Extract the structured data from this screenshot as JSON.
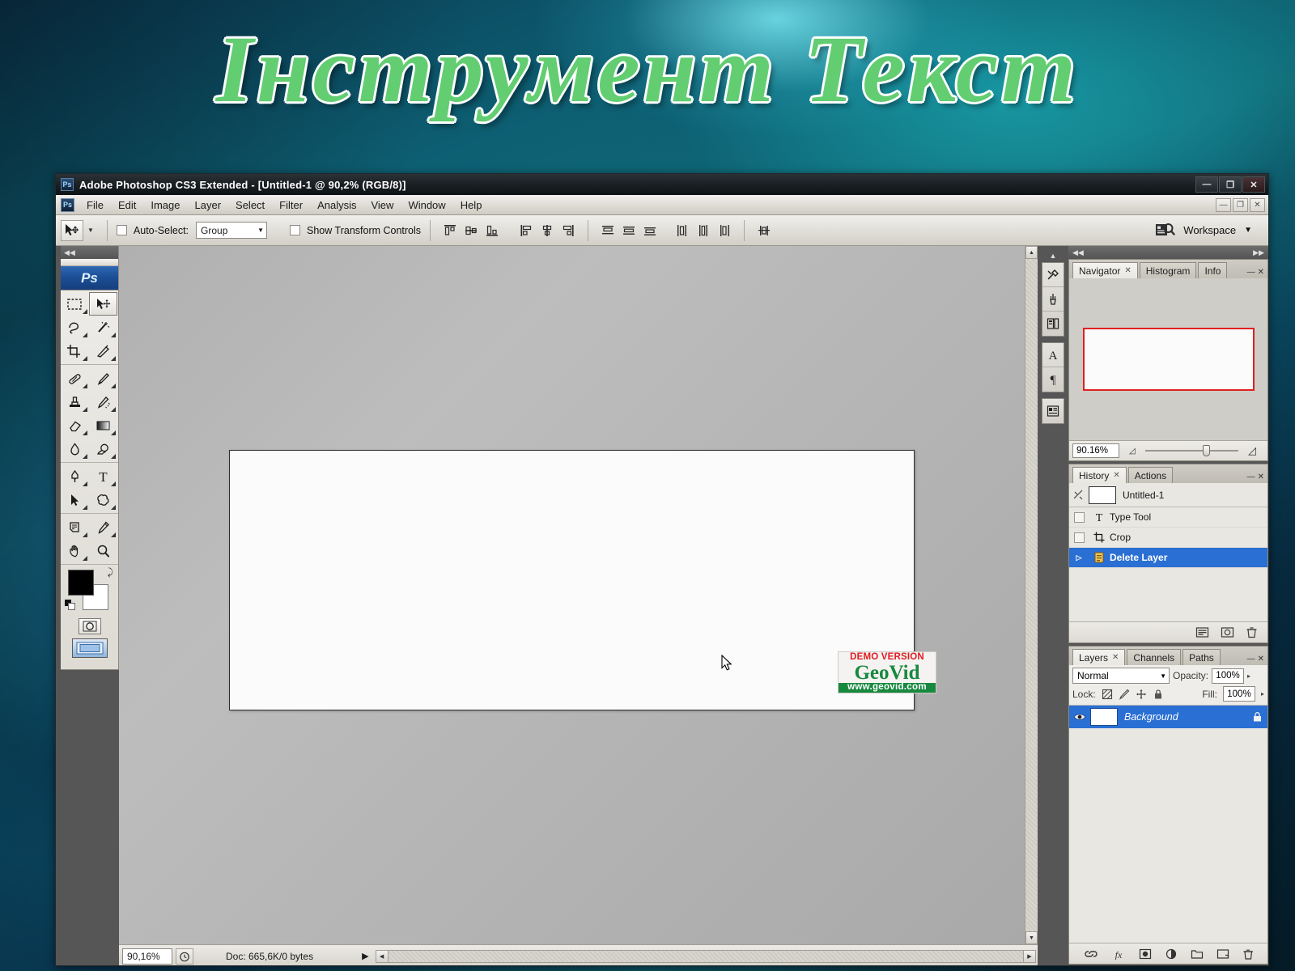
{
  "slide": {
    "title": "Інструмент  Текст"
  },
  "window": {
    "title": "Adobe Photoshop CS3 Extended - [Untitled-1 @ 90,2% (RGB/8)]",
    "logo_label": "Ps",
    "controls": [
      {
        "name": "minimize",
        "glyph": "—"
      },
      {
        "name": "maximize",
        "glyph": "❐"
      },
      {
        "name": "close",
        "glyph": "✕"
      }
    ],
    "doc_controls": [
      {
        "name": "doc-minimize",
        "glyph": "—"
      },
      {
        "name": "doc-restore",
        "glyph": "❐"
      },
      {
        "name": "doc-close",
        "glyph": "✕"
      }
    ]
  },
  "menubar": {
    "items": [
      "File",
      "Edit",
      "Image",
      "Layer",
      "Select",
      "Filter",
      "Analysis",
      "View",
      "Window",
      "Help"
    ]
  },
  "options_bar": {
    "tool_icon": "move-tool-icon",
    "auto_select_label": "Auto-Select:",
    "auto_select_value": "Group",
    "show_transform_label": "Show Transform Controls",
    "align_group_1": [
      "align-top-edges",
      "align-vertical-centers",
      "align-bottom-edges"
    ],
    "align_group_2": [
      "align-left-edges",
      "align-horizontal-centers",
      "align-right-edges"
    ],
    "distribute_group_1": [
      "distribute-top-edges",
      "distribute-vertical-centers",
      "distribute-bottom-edges"
    ],
    "distribute_group_2": [
      "distribute-left-edges",
      "distribute-horizontal-centers",
      "distribute-right-edges"
    ],
    "link_group": [
      "distribute-link"
    ],
    "workspace_label": "Workspace",
    "workspace_caret": "▼",
    "bridge_icon": "go-to-bridge-icon"
  },
  "toolbox": {
    "badge": "Ps",
    "collapse_glyph": "◀◀",
    "groups": [
      {
        "tools": [
          {
            "name": "rectangular-marquee-tool",
            "selected": false
          },
          {
            "name": "move-tool",
            "selected": true
          },
          {
            "name": "lasso-tool",
            "selected": false
          },
          {
            "name": "magic-wand-tool",
            "selected": false
          },
          {
            "name": "crop-tool",
            "selected": false
          },
          {
            "name": "slice-tool",
            "selected": false
          }
        ]
      },
      {
        "tools": [
          {
            "name": "healing-brush-tool",
            "selected": false
          },
          {
            "name": "brush-tool",
            "selected": false
          },
          {
            "name": "clone-stamp-tool",
            "selected": false
          },
          {
            "name": "history-brush-tool",
            "selected": false
          },
          {
            "name": "eraser-tool",
            "selected": false
          },
          {
            "name": "gradient-tool",
            "selected": false
          },
          {
            "name": "blur-tool",
            "selected": false
          },
          {
            "name": "dodge-tool",
            "selected": false
          }
        ]
      },
      {
        "tools": [
          {
            "name": "pen-tool",
            "selected": false
          },
          {
            "name": "horizontal-type-tool",
            "selected": false
          },
          {
            "name": "path-selection-tool",
            "selected": false
          },
          {
            "name": "custom-shape-tool",
            "selected": false
          }
        ]
      },
      {
        "tools": [
          {
            "name": "notes-tool",
            "selected": false
          },
          {
            "name": "eyedropper-tool",
            "selected": false
          },
          {
            "name": "hand-tool",
            "selected": false
          },
          {
            "name": "zoom-tool",
            "selected": false
          }
        ]
      }
    ],
    "foreground_color": "#000000",
    "background_color": "#ffffff",
    "swap_colors_icon": "swap-colors-icon",
    "default_colors_icon": "default-colors-icon",
    "quick_mask_icon": "quick-mask-icon",
    "screen_mode_icon": "screen-mode-icon"
  },
  "canvas": {
    "document_background": "#fbfbfb",
    "watermark": {
      "demo_text": "DEMO VERSION",
      "brand": "GeoVid",
      "url": "www.geovid.com",
      "demo_color": "#e11b22",
      "brand_color": "#17893f"
    }
  },
  "status_bar": {
    "zoom": "90,16%",
    "timing_icon": "timing-icon",
    "doc_info": "Doc: 665,6K/0 bytes",
    "play_glyph": "▶"
  },
  "dock_icons": [
    {
      "name": "tool-presets-icon",
      "glyph": "tools"
    },
    {
      "name": "brushes-icon",
      "glyph": "brush"
    },
    {
      "name": "clone-source-icon",
      "glyph": "clone"
    },
    {
      "name": "character-icon",
      "glyph": "A"
    },
    {
      "name": "paragraph-icon",
      "glyph": "¶"
    },
    {
      "name": "layer-comps-icon",
      "glyph": "comps"
    }
  ],
  "panels": {
    "navigator": {
      "tabs": [
        {
          "label": "Navigator",
          "active": true,
          "closable": true
        },
        {
          "label": "Histogram",
          "active": false,
          "closable": false
        },
        {
          "label": "Info",
          "active": false,
          "closable": false
        }
      ],
      "zoom_value": "90.16%",
      "view_box_color": "#e02020",
      "zoom_out_icon": "zoom-out-icon",
      "zoom_in_icon": "zoom-in-icon"
    },
    "history": {
      "tabs": [
        {
          "label": "History",
          "active": true,
          "closable": true
        },
        {
          "label": "Actions",
          "active": false,
          "closable": false
        }
      ],
      "snapshot": {
        "label": "Untitled-1",
        "icon": "snapshot-icon"
      },
      "states": [
        {
          "label": "Type Tool",
          "icon": "type-tool-icon",
          "active": false
        },
        {
          "label": "Crop",
          "icon": "crop-tool-icon",
          "active": false
        },
        {
          "label": "Delete Layer",
          "icon": "delete-layer-icon",
          "active": true
        }
      ],
      "footer_buttons": [
        {
          "name": "create-document-from-state-icon"
        },
        {
          "name": "create-new-snapshot-icon"
        },
        {
          "name": "delete-state-icon"
        }
      ]
    },
    "layers": {
      "tabs": [
        {
          "label": "Layers",
          "active": true,
          "closable": true
        },
        {
          "label": "Channels",
          "active": false,
          "closable": false
        },
        {
          "label": "Paths",
          "active": false,
          "closable": false
        }
      ],
      "blend_mode": "Normal",
      "opacity_label": "Opacity:",
      "opacity_value": "100%",
      "lock_label": "Lock:",
      "fill_label": "Fill:",
      "fill_value": "100%",
      "lock_icons": [
        {
          "name": "lock-transparent-pixels-icon"
        },
        {
          "name": "lock-image-pixels-icon"
        },
        {
          "name": "lock-position-icon"
        },
        {
          "name": "lock-all-icon"
        }
      ],
      "rows": [
        {
          "name": "Background",
          "visible": true,
          "locked": true,
          "selected": true
        }
      ],
      "footer_buttons": [
        {
          "name": "link-layers-icon"
        },
        {
          "name": "layer-style-icon"
        },
        {
          "name": "layer-mask-icon"
        },
        {
          "name": "adjustment-layer-icon"
        },
        {
          "name": "new-group-icon"
        },
        {
          "name": "new-layer-icon"
        },
        {
          "name": "delete-layer-icon"
        }
      ]
    }
  }
}
